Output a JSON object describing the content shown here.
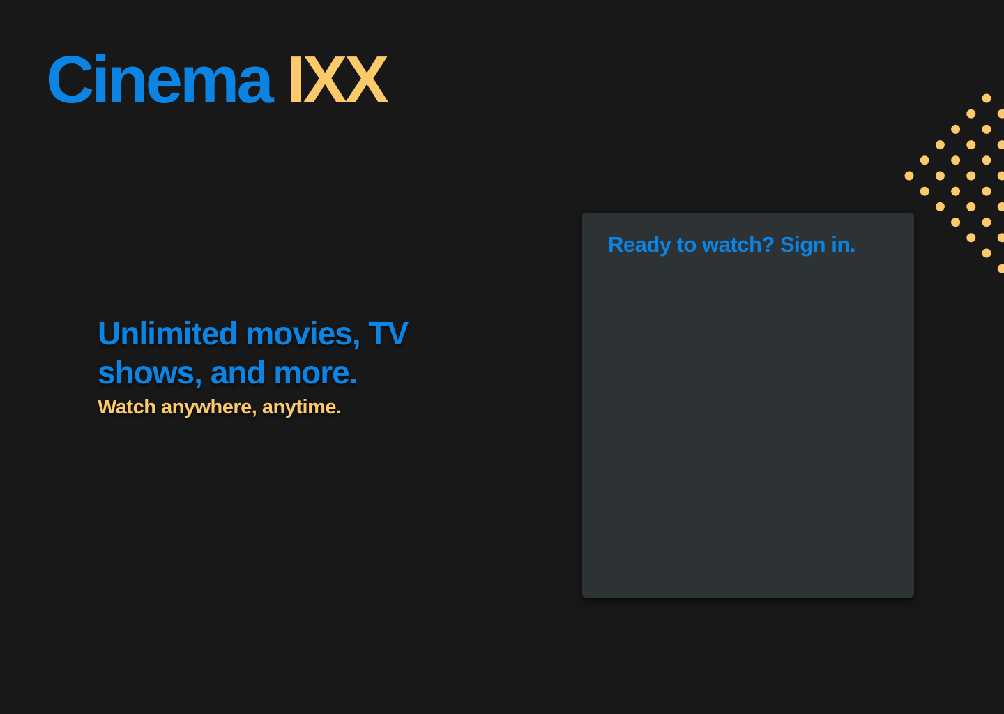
{
  "brand": {
    "part1": "Cinema",
    "part2": "IXX",
    "colors": {
      "primary": "#0b84e3",
      "accent": "#fcc96b",
      "background": "#181818",
      "card": "#2d3335"
    }
  },
  "hero": {
    "title": "Unlimited movies, TV shows, and more.",
    "subtitle": "Watch anywhere, anytime."
  },
  "signin": {
    "title": "Ready to watch? Sign in."
  },
  "decoration": {
    "icon": "dot-grid-pattern"
  }
}
